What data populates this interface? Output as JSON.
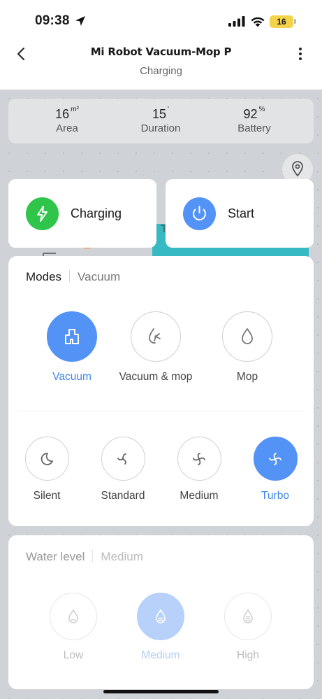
{
  "status": {
    "time": "09:38",
    "battery": "16"
  },
  "header": {
    "title": "Mi Robot Vacuum-Mop P",
    "subtitle": "Charging"
  },
  "stats": [
    {
      "value": "16",
      "unit": "m²",
      "label": "Area"
    },
    {
      "value": "15",
      "unit": "'",
      "label": "Duration"
    },
    {
      "value": "92",
      "unit": "%",
      "label": "Battery"
    }
  ],
  "actions": {
    "charging": {
      "label": "Charging",
      "icon": "lightning-icon",
      "color": "#2fc44a"
    },
    "start": {
      "label": "Start",
      "icon": "power-icon",
      "color": "#5393f5"
    }
  },
  "modes": {
    "title": "Modes",
    "current": "Vacuum",
    "items": [
      {
        "label": "Vacuum",
        "icon": "vacuum-icon",
        "active": true
      },
      {
        "label": "Vacuum & mop",
        "icon": "vacuum-mop-icon",
        "active": false
      },
      {
        "label": "Mop",
        "icon": "water-drop-icon",
        "active": false
      }
    ],
    "suction": [
      {
        "label": "Silent",
        "icon": "moon-icon",
        "active": false
      },
      {
        "label": "Standard",
        "icon": "fan-icon",
        "active": false
      },
      {
        "label": "Medium",
        "icon": "fan-icon",
        "active": false
      },
      {
        "label": "Turbo",
        "icon": "fan-icon",
        "active": true
      }
    ]
  },
  "water": {
    "title": "Water level",
    "current": "Medium",
    "levels": [
      {
        "label": "Low",
        "active": false
      },
      {
        "label": "Medium",
        "active": true
      },
      {
        "label": "High",
        "active": false
      }
    ]
  },
  "colors": {
    "accent": "#5393f5",
    "charging": "#2fc44a",
    "map": "#37b9c4"
  }
}
